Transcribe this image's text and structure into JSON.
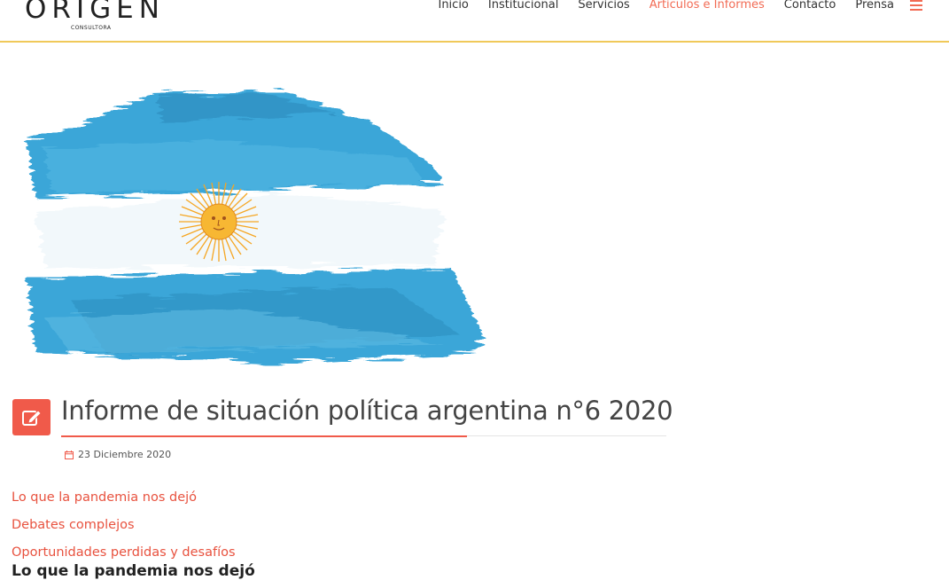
{
  "logo": {
    "name": "ORIGEN",
    "sub": "CONSULTORA"
  },
  "nav": {
    "items": [
      {
        "label": "Inicio"
      },
      {
        "label": "Institucional"
      },
      {
        "label": "Servicios"
      },
      {
        "label": "Articulos e Informes"
      },
      {
        "label": "Contacto"
      },
      {
        "label": "Prensa"
      }
    ],
    "active_index": 3,
    "menu_icon": "hamburger-icon"
  },
  "article": {
    "title": "Informe de situación política argentina n°6 2020",
    "date": "23 Diciembre 2020",
    "badge_icon": "edit-icon",
    "date_icon": "calendar-icon",
    "image": "argentina-flag-illustration"
  },
  "toc": {
    "links": [
      "Lo que la pandemia nos dejó",
      "Debates complejos",
      "Oportunidades perdidas y desafíos"
    ]
  },
  "section": {
    "heading": "Lo que la pandemia nos dejó"
  },
  "colors": {
    "accent": "#f05a4a",
    "header_rule": "#f0c95a",
    "flag_blue": "#3aa6d8",
    "sun": "#f5a623"
  }
}
